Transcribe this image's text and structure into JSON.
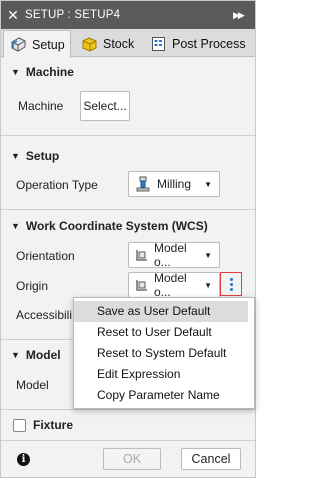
{
  "titlebar": {
    "title": "SETUP : SETUP4",
    "close_glyph": "✕",
    "expand_glyph": "▶▶"
  },
  "tabs": [
    {
      "label": "Setup",
      "icon": "setup-icon"
    },
    {
      "label": "Stock",
      "icon": "stock-icon"
    },
    {
      "label": "Post Process",
      "icon": "post-process-icon"
    }
  ],
  "machine": {
    "header": "Machine",
    "label": "Machine",
    "button": "Select..."
  },
  "setup": {
    "header": "Setup",
    "op_label": "Operation Type",
    "op_value": "Milling"
  },
  "wcs": {
    "header": "Work Coordinate System (WCS)",
    "orientation_label": "Orientation",
    "orientation_value": "Model o...",
    "origin_label": "Origin",
    "origin_value": "Model o...",
    "accessibility_label": "Accessibili"
  },
  "model": {
    "header": "Model",
    "label": "Model"
  },
  "fixture": {
    "label": "Fixture"
  },
  "context_menu": [
    "Save as User Default",
    "Reset to User Default",
    "Reset to System Default",
    "Edit Expression",
    "Copy Parameter Name"
  ],
  "footer": {
    "ok": "OK",
    "cancel": "Cancel",
    "info": "i"
  },
  "colors": {
    "titlebar": "#5a5a5a",
    "accent_blue": "#2a79c7",
    "highlight_red": "#e04040",
    "stock_yellow": "#f0c419"
  }
}
